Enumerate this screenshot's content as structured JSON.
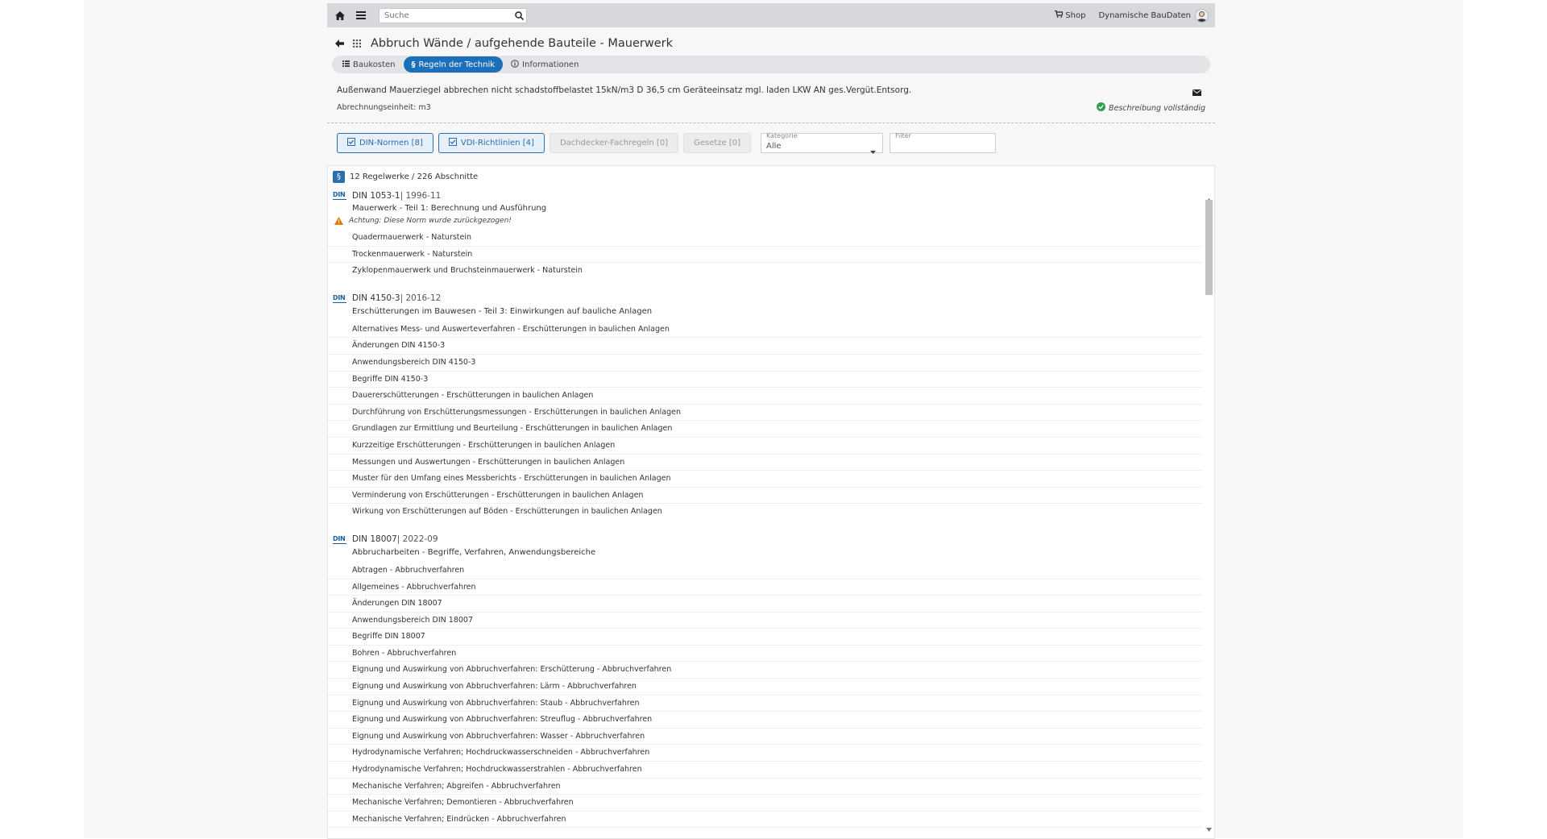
{
  "nav": {
    "search_placeholder": "Suche",
    "shop_label": "Shop",
    "user_label": "Dynamische BauDaten"
  },
  "page": {
    "title": "Abbruch Wände / aufgehende Bauteile - Mauerwerk"
  },
  "tabs": [
    {
      "label": "Baukosten",
      "icon": "list-icon",
      "active": false
    },
    {
      "label": "Regeln der Technik",
      "icon": "paragraph-icon",
      "active": true
    },
    {
      "label": "Informationen",
      "icon": "info-icon",
      "active": false
    }
  ],
  "description": {
    "text": "Außenwand Mauerziegel abbrechen nicht schadstoffbelastet 15kN/m3 D 36,5 cm Geräteeinsatz mgl. laden LKW AN ges.Vergüt.Entsorg.",
    "unit": "Abrechnungseinheit: m3",
    "status": "Beschreibung vollständig"
  },
  "filters": {
    "din": "DIN-Normen [8]",
    "vdi": "VDI-Richtlinien [4]",
    "dach": "Dachdecker-Fachregeln [0]",
    "gesetze": "Gesetze [0]",
    "kategorie_label": "Kategorie",
    "kategorie_value": "Alle",
    "filter_label": "Filter"
  },
  "results": {
    "summary": "12 Regelwerke / 226 Abschnitte",
    "norms": [
      {
        "logo": "DIN",
        "code": "DIN 1053-1",
        "date": " | 1996-11",
        "title": "Mauerwerk - Teil 1: Berechnung und Ausführung",
        "warning": "Achtung: Diese Norm wurde zurückgezogen!",
        "items": [
          "Quadermauerwerk - Naturstein",
          "Trockenmauerwerk - Naturstein",
          "Zyklopenmauerwerk und Bruchsteinmauerwerk - Naturstein"
        ]
      },
      {
        "logo": "DIN",
        "code": "DIN 4150-3",
        "date": " | 2016-12",
        "title": "Erschütterungen im Bauwesen - Teil 3: Einwirkungen auf bauliche Anlagen",
        "items": [
          "Alternatives Mess- und Auswerteverfahren - Erschütterungen in baulichen Anlagen",
          "Änderungen DIN 4150-3",
          "Anwendungsbereich DIN 4150-3",
          "Begriffe DIN 4150-3",
          "Dauererschütterungen - Erschütterungen in baulichen Anlagen",
          "Durchführung von Erschütterungsmessungen - Erschütterungen in baulichen Anlagen",
          "Grundlagen zur Ermittlung und Beurteilung - Erschütterungen in baulichen Anlagen",
          "Kurzzeitige Erschütterungen - Erschütterungen in baulichen Anlagen",
          "Messungen und Auswertungen - Erschütterungen in baulichen Anlagen",
          "Muster für den Umfang eines Messberichts - Erschütterungen in baulichen Anlagen",
          "Verminderung von Erschütterungen - Erschütterungen in baulichen Anlagen",
          "Wirkung von Erschütterungen auf Böden - Erschütterungen in baulichen Anlagen"
        ]
      },
      {
        "logo": "DIN",
        "code": "DIN 18007",
        "date": " | 2022-09",
        "title": "Abbrucharbeiten - Begriffe, Verfahren, Anwendungsbereiche",
        "items": [
          "Abtragen - Abbruchverfahren",
          "Allgemeines - Abbruchverfahren",
          "Änderungen DIN 18007",
          "Anwendungsbereich DIN 18007",
          "Begriffe DIN 18007",
          "Bohren - Abbruchverfahren",
          "Eignung und Auswirkung von Abbruchverfahren: Erschütterung - Abbruchverfahren",
          "Eignung und Auswirkung von Abbruchverfahren: Lärm - Abbruchverfahren",
          "Eignung und Auswirkung von Abbruchverfahren: Staub - Abbruchverfahren",
          "Eignung und Auswirkung von Abbruchverfahren: Streuflug - Abbruchverfahren",
          "Eignung und Auswirkung von Abbruchverfahren: Wasser - Abbruchverfahren",
          "Hydrodynamische Verfahren; Hochdruckwasserschneiden - Abbruchverfahren",
          "Hydrodynamische Verfahren; Hochdruckwasserstrahlen - Abbruchverfahren",
          "Mechanische Verfahren; Abgreifen - Abbruchverfahren",
          "Mechanische Verfahren; Demontieren - Abbruchverfahren",
          "Mechanische Verfahren; Eindrücken - Abbruchverfahren"
        ]
      }
    ]
  }
}
